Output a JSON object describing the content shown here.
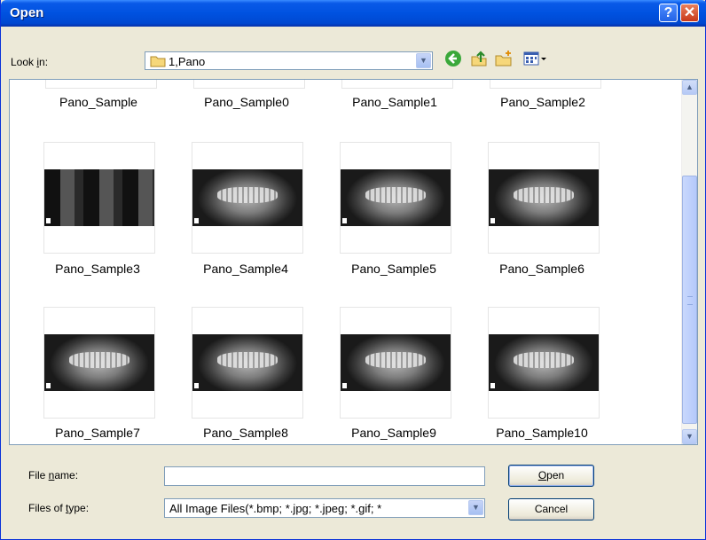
{
  "window": {
    "title": "Open",
    "help_glyph": "?",
    "close_glyph": "✕"
  },
  "toolbar": {
    "look_in_prefix": "Look ",
    "look_in_mnemonic": "i",
    "look_in_suffix": "n:",
    "folder": "1,Pano",
    "icons": [
      "back-icon",
      "up-folder-icon",
      "new-folder-icon",
      "view-menu-icon"
    ]
  },
  "files": {
    "partial_row": [
      "Pano_Sample",
      "Pano_Sample0",
      "Pano_Sample1",
      "Pano_Sample2"
    ],
    "rows": [
      [
        "Pano_Sample3",
        "Pano_Sample4",
        "Pano_Sample5",
        "Pano_Sample6"
      ],
      [
        "Pano_Sample7",
        "Pano_Sample8",
        "Pano_Sample9",
        "Pano_Sample10"
      ]
    ]
  },
  "form": {
    "file_name_prefix": "File ",
    "file_name_mnemonic": "n",
    "file_name_suffix": "ame:",
    "file_name_value": "",
    "file_type_prefix": "Files of ",
    "file_type_mnemonic": "t",
    "file_type_suffix": "ype:",
    "file_type_value": "All Image Files(*.bmp; *.jpg; *.jpeg; *.gif; *"
  },
  "buttons": {
    "open_mnemonic": "O",
    "open_rest": "pen",
    "cancel": "Cancel"
  }
}
